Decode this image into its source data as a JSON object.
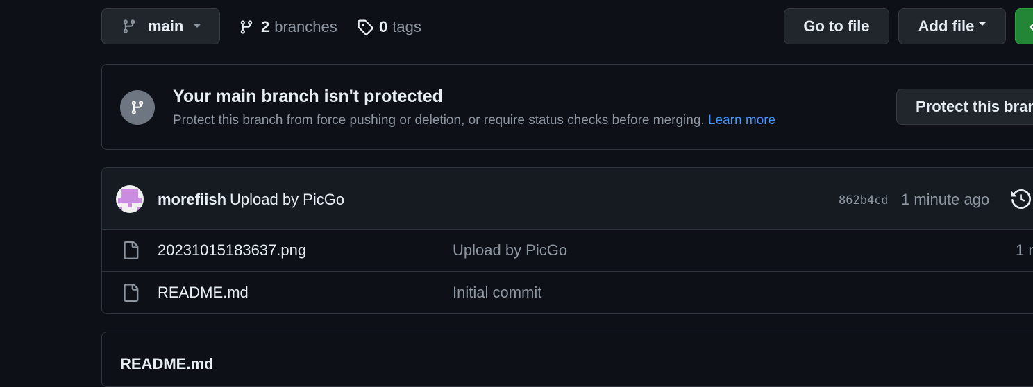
{
  "toolbar": {
    "branch_selector": "main",
    "branch_count": "2",
    "branch_word": "branches",
    "tag_count": "0",
    "tag_word": "tags",
    "go_to_file": "Go to file",
    "add_file": "Add file"
  },
  "protection_banner": {
    "title": "Your main branch isn't protected",
    "description": "Protect this branch from force pushing or deletion, or require status checks before merging.",
    "learn_more": "Learn more",
    "button": "Protect this bran"
  },
  "latest_commit": {
    "author": "morefiish",
    "message": "Upload by PicGo",
    "hash": "862b4cd",
    "time": "1 minute ago"
  },
  "files": [
    {
      "name": "20231015183637.png",
      "commit_message": "Upload by PicGo",
      "time": "1 m"
    },
    {
      "name": "README.md",
      "commit_message": "Initial commit",
      "time": ""
    }
  ],
  "readme": {
    "title": "README.md"
  },
  "colors": {
    "accent_link": "#4493f8",
    "green_button": "#238636",
    "background": "#0d1117"
  }
}
